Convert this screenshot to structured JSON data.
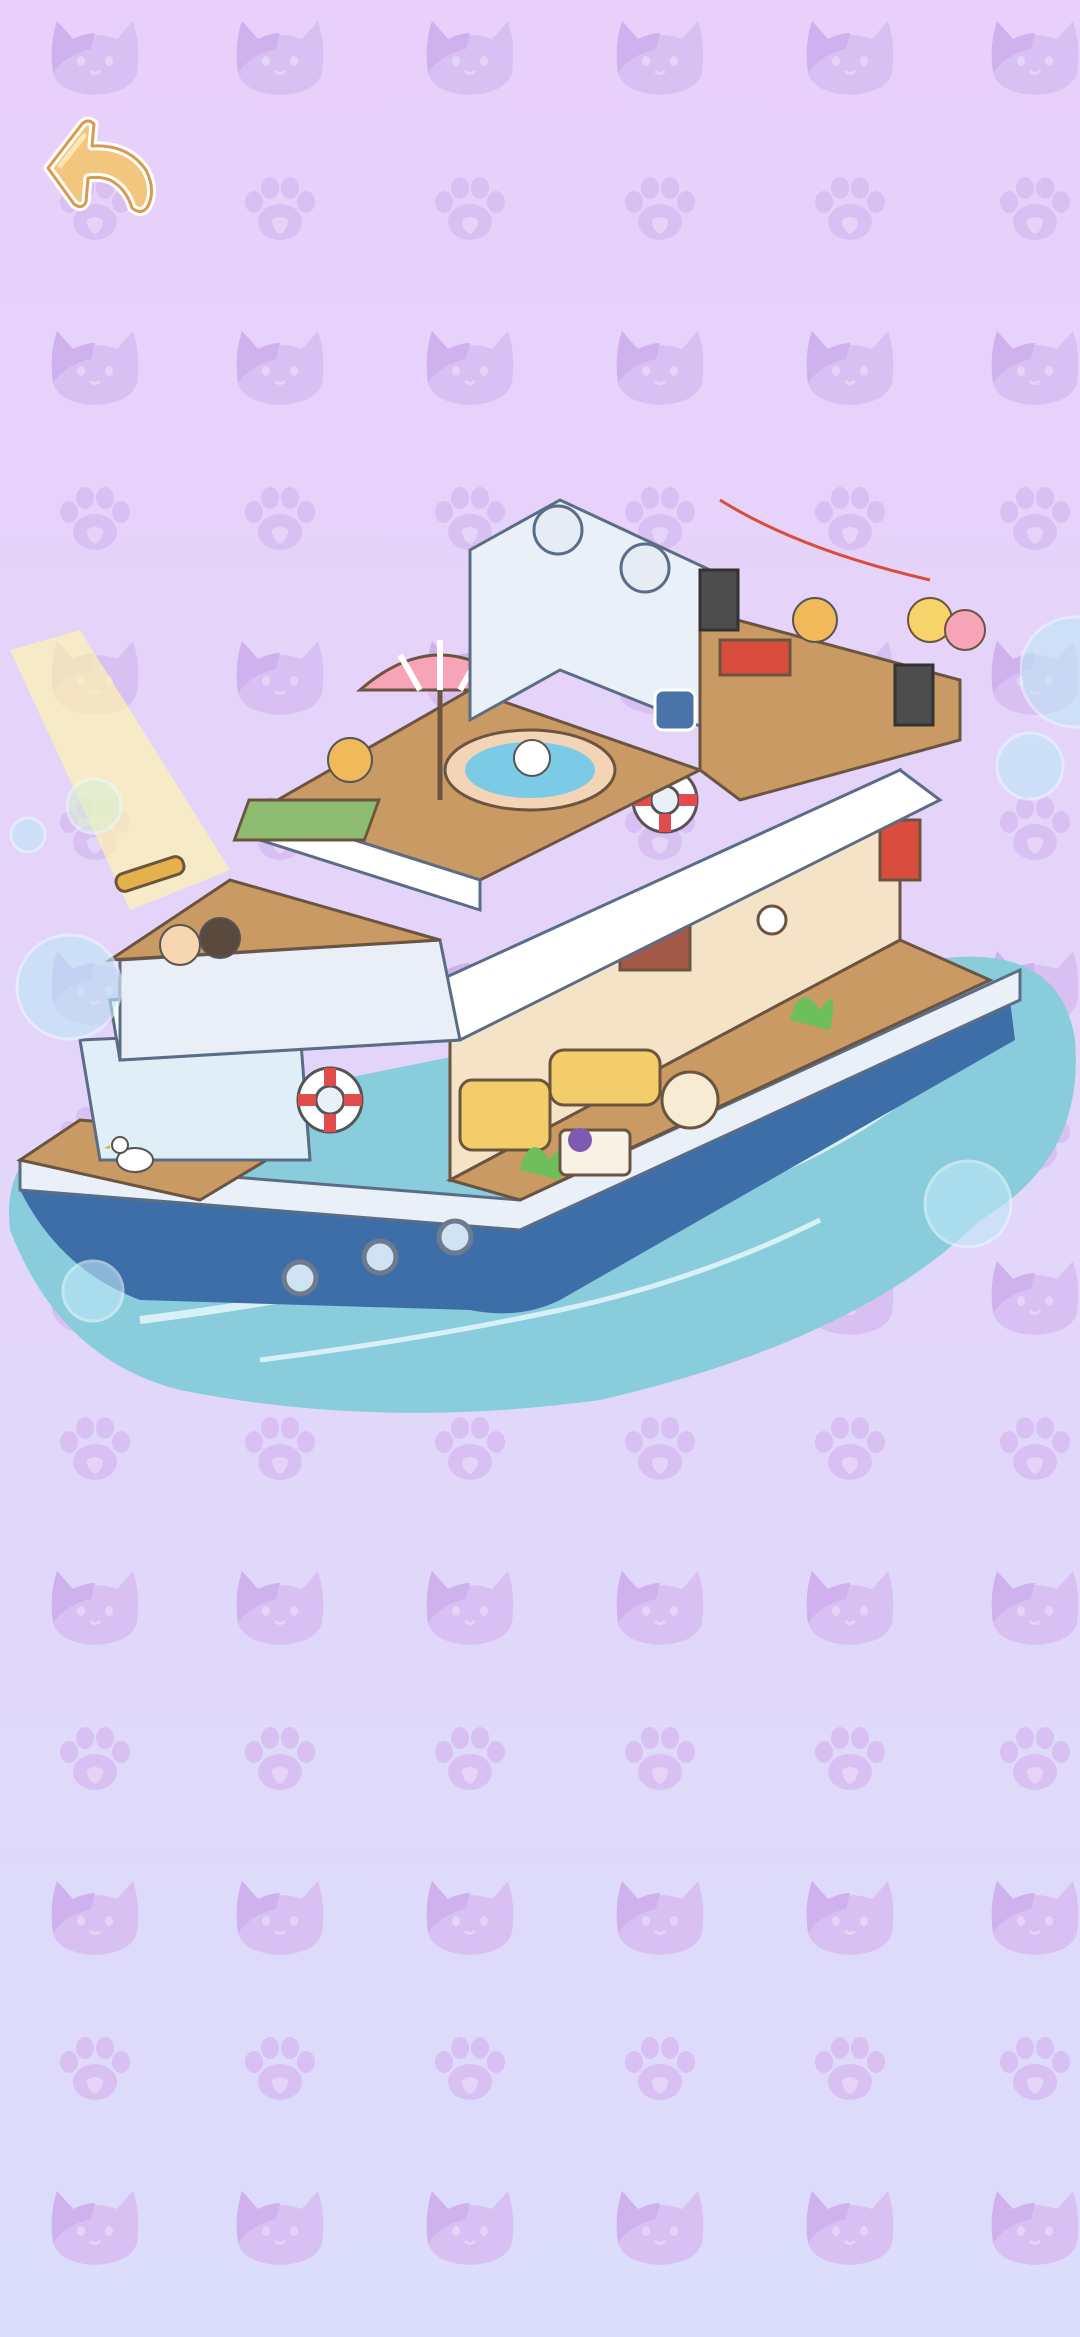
{
  "screen": "boat-room-view",
  "colors": {
    "bg_top": "#e8d0fb",
    "bg_bottom": "#dcdcfb",
    "pattern": "#dcc3f3",
    "sea": "#87cbdc",
    "hull": "#3f6fa8",
    "deck_wood": "#c99a63",
    "back_button": "#f0c179"
  },
  "icons": {
    "back": "curved-back-arrow-icon",
    "pattern": [
      "cat-face-icon",
      "paw-print-icon"
    ]
  }
}
